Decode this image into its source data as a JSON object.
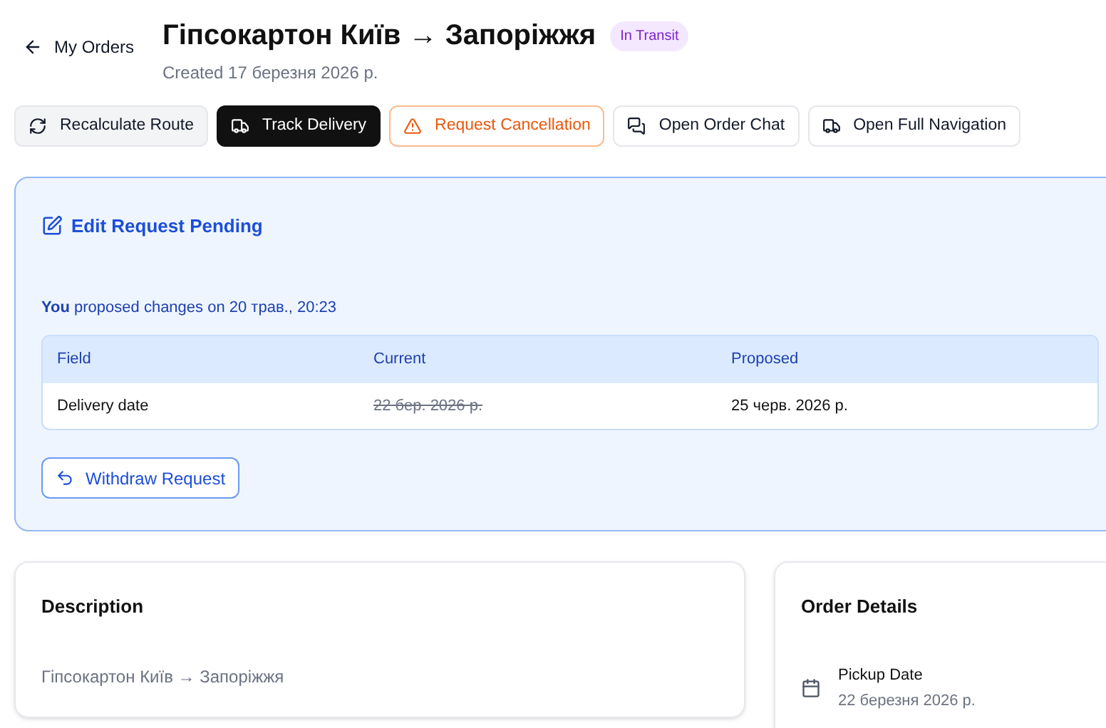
{
  "header": {
    "back_link": "My Orders",
    "title": "Гіпсокартон Київ → Запоріжжя",
    "status_badge": "In Transit",
    "created": "Created 17 березня 2026 р."
  },
  "actions": [
    {
      "label": "Recalculate Route",
      "kind": "secondary"
    },
    {
      "label": "Track Delivery",
      "kind": "primary"
    },
    {
      "label": "Request Cancellation",
      "kind": "danger"
    },
    {
      "label": "Open Order Chat",
      "kind": "outline"
    },
    {
      "label": "Open Full Navigation",
      "kind": "outline"
    }
  ],
  "pending_request": {
    "title": "Edit Request Pending",
    "note": "**You** proposed changes on 20 трав., 20:23",
    "table": {
      "columns": [
        "Field",
        "Current",
        "Proposed"
      ],
      "rows": [
        {
          "field": "Delivery date",
          "current": "22 бер. 2026 р.",
          "proposed": "25 черв. 2026 р.",
          "current_struck": true
        }
      ]
    },
    "withdraw_button": "Withdraw Request"
  },
  "description": {
    "title": "Description",
    "text": "Гіпсокартон Київ → Запоріжжя"
  },
  "order_details": {
    "title": "Order Details",
    "items": [
      {
        "label": "Pickup Date",
        "value": "22 березня 2026 р."
      }
    ]
  }
}
